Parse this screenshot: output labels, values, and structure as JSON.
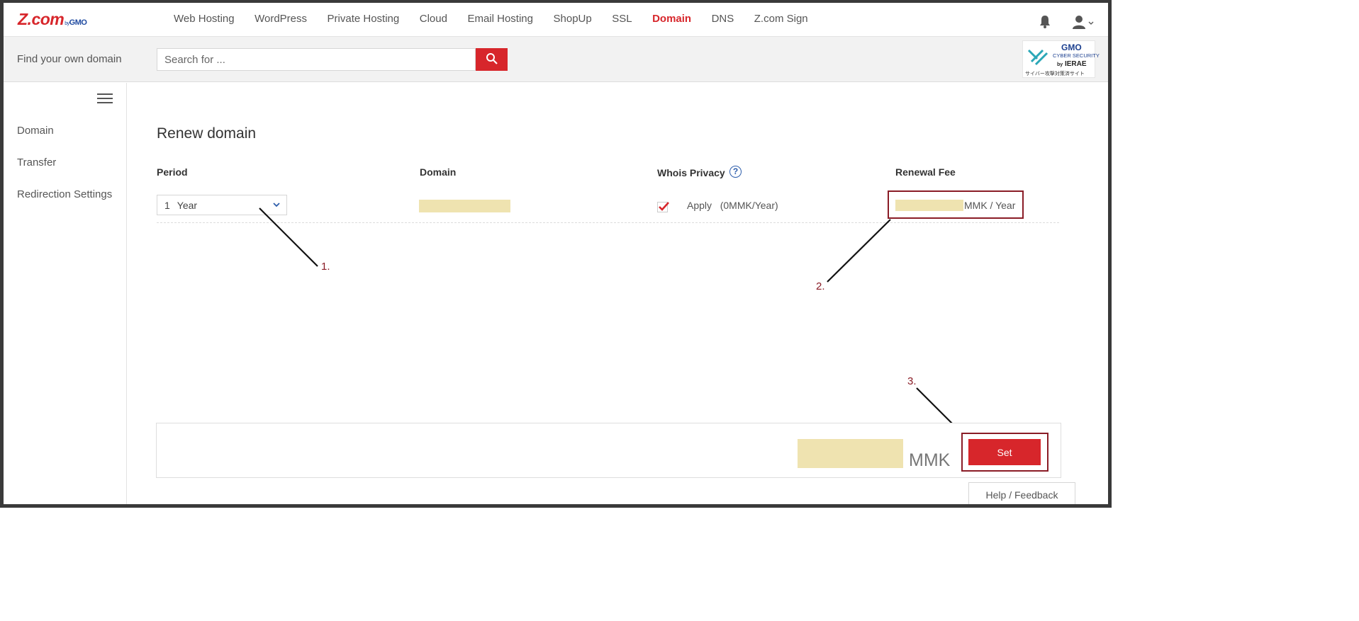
{
  "logo": {
    "main": "Z.com",
    "by": "by",
    "gmo": "GMO"
  },
  "nav": {
    "items": [
      {
        "label": "Web Hosting",
        "active": false
      },
      {
        "label": "WordPress",
        "active": false
      },
      {
        "label": "Private Hosting",
        "active": false
      },
      {
        "label": "Cloud",
        "active": false
      },
      {
        "label": "Email Hosting",
        "active": false
      },
      {
        "label": "ShopUp",
        "active": false
      },
      {
        "label": "SSL",
        "active": false
      },
      {
        "label": "Domain",
        "active": true
      },
      {
        "label": "DNS",
        "active": false
      },
      {
        "label": "Z.com Sign",
        "active": false
      }
    ],
    "bell_icon": "bell-icon",
    "user_icon": "user-icon"
  },
  "search": {
    "label": "Find your own domain",
    "placeholder": "Search for ...",
    "button_icon": "search-icon"
  },
  "badge": {
    "gmo": "GMO",
    "cyber": "CYBER SECURITY",
    "by": "by",
    "ierae": "IERAE",
    "jp": "サイバー攻撃対策済サイト"
  },
  "sidebar": {
    "menu_icon": "hamburger-icon",
    "items": [
      {
        "label": "Domain"
      },
      {
        "label": "Transfer"
      },
      {
        "label": "Redirection Settings"
      }
    ]
  },
  "main": {
    "title": "Renew domain",
    "columns": {
      "period": "Period",
      "domain": "Domain",
      "whois": "Whois Privacy",
      "fee": "Renewal Fee"
    },
    "period_value": "1",
    "period_unit": "Year",
    "whois_checked": true,
    "whois_apply": "Apply",
    "whois_price": "(0MMK/Year)",
    "fee_unit": "MMK / Year"
  },
  "annotations": [
    "1.",
    "2.",
    "3."
  ],
  "footer": {
    "currency": "MMK",
    "set_label": "Set",
    "help_label": "Help / Feedback"
  },
  "colors": {
    "brand_red": "#d7262b",
    "annotation": "#8a1c26",
    "masked": "#efe3b0"
  }
}
